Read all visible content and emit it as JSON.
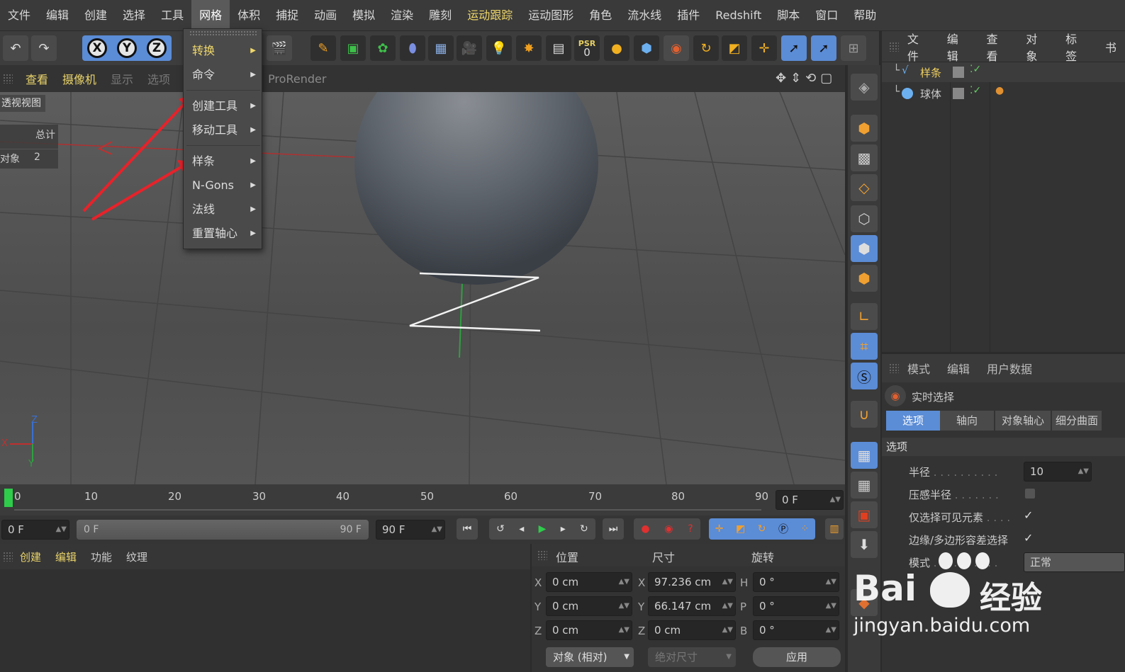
{
  "menubar": {
    "items": [
      "文件",
      "编辑",
      "创建",
      "选择",
      "工具",
      "网格",
      "体积",
      "捕捉",
      "动画",
      "模拟",
      "渲染",
      "雕刻",
      "运动跟踪",
      "运动图形",
      "角色",
      "流水线",
      "插件",
      "Redshift",
      "脚本",
      "窗口",
      "帮助"
    ]
  },
  "dropdown": {
    "items": [
      "转换",
      "命令",
      "创建工具",
      "移动工具",
      "样条",
      "N-Gons",
      "法线",
      "重置轴心"
    ]
  },
  "toolbar": {
    "axis_x": "X",
    "axis_y": "Y",
    "axis_z": "Z",
    "psr_label": "PSR",
    "psr_value": "0"
  },
  "viewport": {
    "tabs": [
      "查看",
      "摄像机",
      "显示",
      "选项"
    ],
    "renderer_label": "ProRender",
    "view_name": "透视视图",
    "stats_total_label": "总计",
    "stats_objects_label": "对象",
    "stats_objects_value": "2",
    "axis_x": "X",
    "axis_y": "Y",
    "axis_z": "Z"
  },
  "object_manager": {
    "menu": [
      "文件",
      "编辑",
      "查看",
      "对象",
      "标签",
      "书"
    ],
    "objects": [
      {
        "name": "样条",
        "icon": "spline-icon"
      },
      {
        "name": "球体",
        "icon": "sphere-icon"
      }
    ]
  },
  "attribute_manager": {
    "menu": [
      "模式",
      "编辑",
      "用户数据"
    ],
    "tool_name": "实时选择",
    "tabs": [
      "选项",
      "轴向",
      "对象轴心",
      "细分曲面"
    ],
    "section": "选项",
    "rows": [
      {
        "label": "半径",
        "value": "10"
      },
      {
        "label": "压感半径",
        "value": ""
      },
      {
        "label": "仅选择可见元素",
        "value": "✓"
      },
      {
        "label": "边缘/多边形容差选择",
        "value": "✓"
      },
      {
        "label": "模式",
        "value": "正常"
      }
    ]
  },
  "timeline": {
    "ticks": [
      "0",
      "10",
      "20",
      "30",
      "40",
      "50",
      "60",
      "70",
      "80",
      "90"
    ],
    "current_frame": "0 F"
  },
  "transport": {
    "start_frame": "0 F",
    "range_start": "0 F",
    "range_end": "90 F",
    "end_frame": "90 F"
  },
  "material_manager": {
    "menu": [
      "创建",
      "编辑",
      "功能",
      "纹理"
    ]
  },
  "coordinates": {
    "headers": [
      "位置",
      "尺寸",
      "旋转"
    ],
    "rows": [
      {
        "pos_axis": "X",
        "pos": "0 cm",
        "size_axis": "X",
        "size": "97.236 cm",
        "rot_axis": "H",
        "rot": "0 °"
      },
      {
        "pos_axis": "Y",
        "pos": "0 cm",
        "size_axis": "Y",
        "size": "66.147 cm",
        "rot_axis": "P",
        "rot": "0 °"
      },
      {
        "pos_axis": "Z",
        "pos": "0 cm",
        "size_axis": "Z",
        "size": "0 cm",
        "rot_axis": "B",
        "rot": "0 °"
      }
    ],
    "mode_select": "对象 (相对)",
    "size_select": "绝对尺寸",
    "apply_label": "应用"
  },
  "watermark": {
    "brand": "Bai",
    "brand2": "经验",
    "url": "jingyan.baidu.com"
  },
  "colors": {
    "accent_yellow": "#e9d36a",
    "accent_blue": "#5b8cd6",
    "arrow_red": "#e8222a"
  }
}
